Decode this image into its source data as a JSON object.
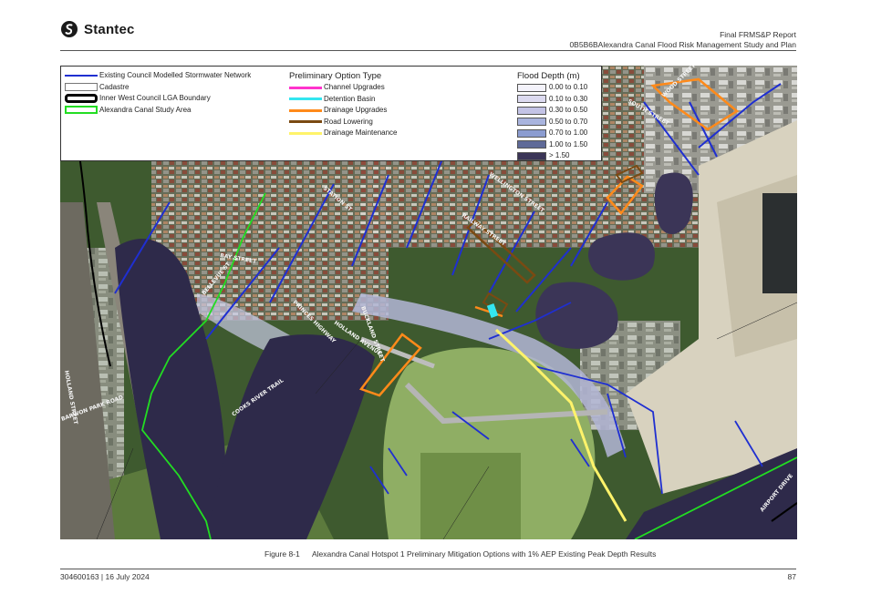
{
  "header": {
    "brand": "Stantec",
    "report_title": "Final FRMS&P Report",
    "report_subtitle": "0B5B6BAlexandra Canal Flood Risk Management Study and Plan"
  },
  "legend": {
    "layers": [
      {
        "label": "Existing Council Modelled Stormwater Network",
        "color": "#1f2fd1",
        "style": "line"
      },
      {
        "label": "Cadastre",
        "color": "#777777",
        "style": "hollow"
      },
      {
        "label": "Inner West Council LGA Boundary",
        "color": "#000000",
        "style": "thick"
      },
      {
        "label": "Alexandra Canal Study Area",
        "color": "#22dd22",
        "style": "hollow-green"
      }
    ],
    "option_title": "Preliminary Option Type",
    "options": [
      {
        "label": "Channel Upgrades",
        "color": "#ff33cc"
      },
      {
        "label": "Detention Basin",
        "color": "#33e6f0"
      },
      {
        "label": "Drainage Upgrades",
        "color": "#ff8a1a"
      },
      {
        "label": "Road Lowering",
        "color": "#7a4a12"
      },
      {
        "label": "Drainage Maintenance",
        "color": "#fff36a"
      }
    ],
    "depth_title": "Flood Depth (m)",
    "depth_classes": [
      {
        "label": "0.00 to 0.10",
        "color": "#f4f3fb"
      },
      {
        "label": "0.10 to 0.30",
        "color": "#dcdaf0"
      },
      {
        "label": "0.30 to 0.50",
        "color": "#c3c3e6"
      },
      {
        "label": "0.50 to 0.70",
        "color": "#a9b4de"
      },
      {
        "label": "0.70 to 1.00",
        "color": "#8b9cd0"
      },
      {
        "label": "1.00 to 1.50",
        "color": "#5f6a98"
      },
      {
        "label": "> 1.50",
        "color": "#3b3557"
      }
    ]
  },
  "map": {
    "streets": [
      "SOUTH STREET",
      "WOOD STREET",
      "WELLINGTON STREET",
      "RAILWAY STREET",
      "BAY STREET",
      "PRINCES HIGHWAY",
      "BELLEVUE ST",
      "STATION ST",
      "BUCKLAND STREET",
      "HOLLAND AVENUE",
      "COOKS RIVER TRAIL",
      "AIRPORT DRIVE",
      "HOLLAND STREET",
      "BARWON PARK ROAD"
    ]
  },
  "caption": {
    "number": "Figure 8-1",
    "text": "Alexandra Canal Hotspot 1 Preliminary Mitigation Options with 1% AEP Existing Peak Depth Results"
  },
  "footer": {
    "doc_ref": "304600163 | 16 July 2024",
    "page": "87"
  }
}
